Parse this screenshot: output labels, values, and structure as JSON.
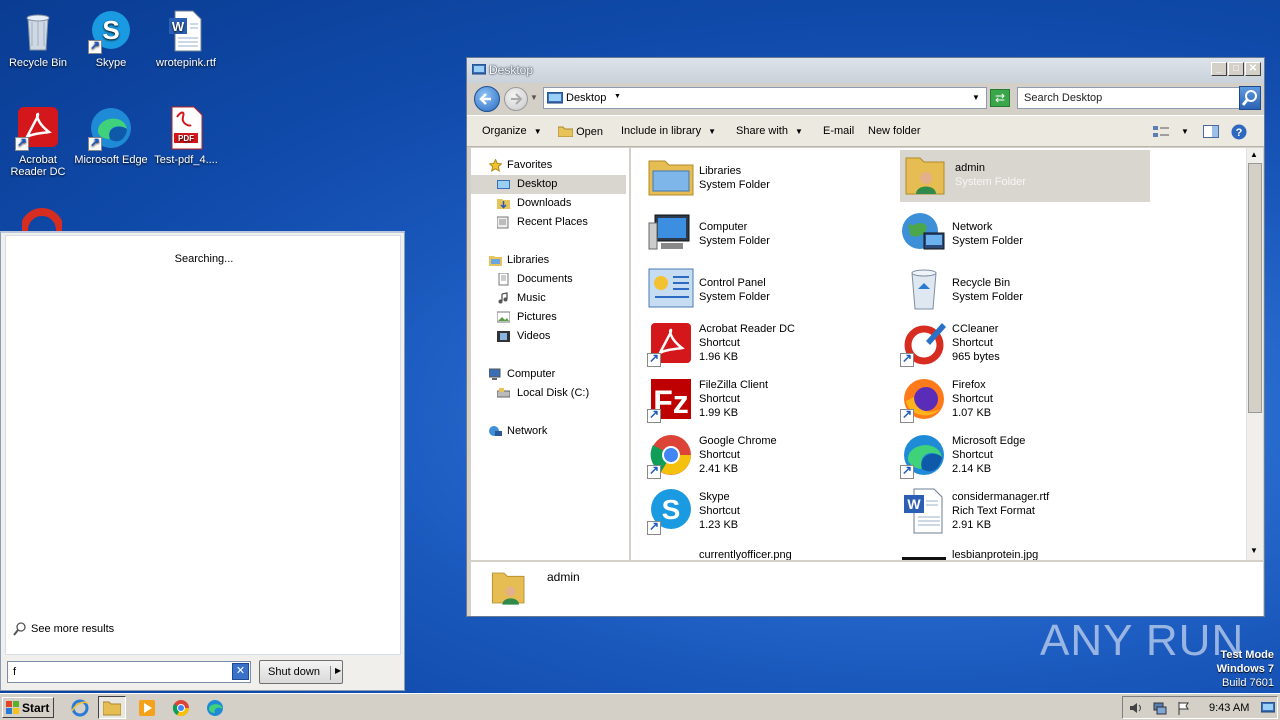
{
  "desktop": {
    "icons": [
      {
        "label": "Recycle Bin"
      },
      {
        "label": "Skype"
      },
      {
        "label": "wrotepink.rtf"
      },
      {
        "label": "Acrobat Reader DC"
      },
      {
        "label": "Microsoft Edge"
      },
      {
        "label": "Test-pdf_4...."
      }
    ]
  },
  "start_menu": {
    "status": "Searching...",
    "see_more": "See more results",
    "search_value": "f",
    "clear_label": "✕",
    "shutdown_label": "Shut down",
    "shutdown_arrow": "▶"
  },
  "explorer": {
    "title": "Desktop",
    "address": "Desktop",
    "search_placeholder": "Search Desktop",
    "toolbar": {
      "organize": "Organize",
      "open": "Open",
      "include": "Include in library",
      "share": "Share with",
      "email": "E-mail",
      "newfolder": "New folder"
    },
    "nav": {
      "favorites": "Favorites",
      "desktop": "Desktop",
      "downloads": "Downloads",
      "recent": "Recent Places",
      "libraries": "Libraries",
      "documents": "Documents",
      "music": "Music",
      "pictures": "Pictures",
      "videos": "Videos",
      "computer": "Computer",
      "localdisk": "Local Disk (C:)",
      "network": "Network"
    },
    "items": [
      {
        "name": "Libraries",
        "type": "System Folder",
        "size": ""
      },
      {
        "name": "admin",
        "type": "System Folder",
        "size": ""
      },
      {
        "name": "Computer",
        "type": "System Folder",
        "size": ""
      },
      {
        "name": "Network",
        "type": "System Folder",
        "size": ""
      },
      {
        "name": "Control Panel",
        "type": "System Folder",
        "size": ""
      },
      {
        "name": "Recycle Bin",
        "type": "System Folder",
        "size": ""
      },
      {
        "name": "Acrobat Reader DC",
        "type": "Shortcut",
        "size": "1.96 KB"
      },
      {
        "name": "CCleaner",
        "type": "Shortcut",
        "size": "965 bytes"
      },
      {
        "name": "FileZilla Client",
        "type": "Shortcut",
        "size": "1.99 KB"
      },
      {
        "name": "Firefox",
        "type": "Shortcut",
        "size": "1.07 KB"
      },
      {
        "name": "Google Chrome",
        "type": "Shortcut",
        "size": "2.41 KB"
      },
      {
        "name": "Microsoft Edge",
        "type": "Shortcut",
        "size": "2.14 KB"
      },
      {
        "name": "Skype",
        "type": "Shortcut",
        "size": "1.23 KB"
      },
      {
        "name": "considermanager.rtf",
        "type": "Rich Text Format",
        "size": "2.91 KB"
      },
      {
        "name": "currentlyofficer.png",
        "type": "",
        "size": ""
      },
      {
        "name": "lesbianprotein.jpg",
        "type": "",
        "size": ""
      }
    ],
    "details_name": "admin"
  },
  "taskbar": {
    "start": "Start",
    "clock": "9:43 AM"
  },
  "watermark": "ANY RUN",
  "testmode": {
    "l1": "Test Mode",
    "l2": "Windows 7",
    "l3": "Build 7601"
  },
  "colors": {
    "selection": "#d9d6cf",
    "accent": "#1b5ac4"
  }
}
